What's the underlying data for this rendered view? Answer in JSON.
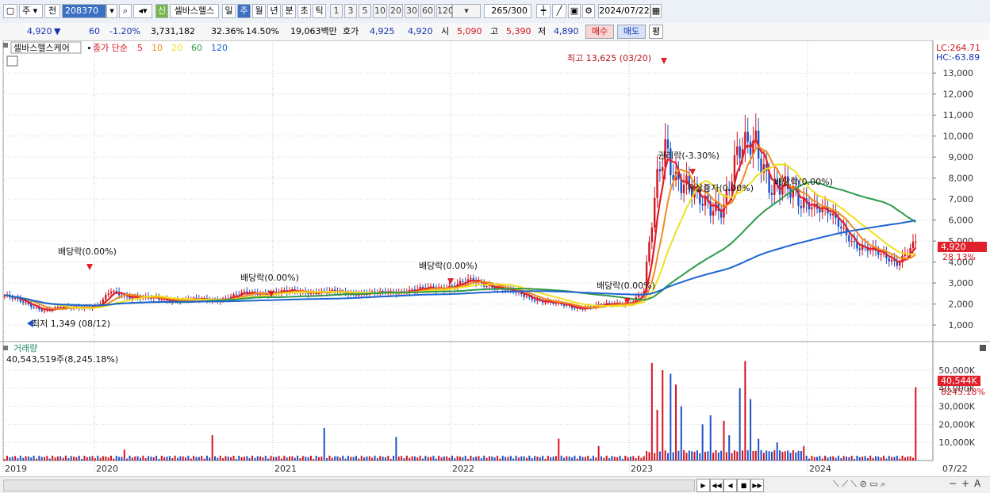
{
  "toolbar": {
    "market_type": "주",
    "prev_label": "전",
    "code": "208370",
    "badge_new": "신",
    "name": "셀바스헬스",
    "periods": [
      "일",
      "주",
      "월",
      "년",
      "분",
      "초",
      "틱"
    ],
    "active_period": "주",
    "intervals": [
      "1",
      "3",
      "5",
      "10",
      "20",
      "30",
      "60",
      "120"
    ],
    "count": "265",
    "count_total": "/300",
    "date": "2024/07/22"
  },
  "quote": {
    "price": "4,920",
    "arrow": "▼",
    "change": "60",
    "change_pct": "-1.20%",
    "volume": "3,731,182",
    "vol_ratio": "32.36%",
    "turnover_pct": "14.50%",
    "amount": "19,063백만",
    "bid_label": "호가",
    "bid1": "4,925",
    "bid2": "4,920",
    "open_label": "시",
    "open": "5,090",
    "high_label": "고",
    "high": "5,390",
    "low_label": "저",
    "low": "4,890",
    "buy_label": "매수",
    "sell_label": "매도",
    "eval_label": "평"
  },
  "chart": {
    "stock_label": "셀바스헬스케어",
    "ma_title": "종가 단순",
    "ma_periods": [
      "5",
      "10",
      "20",
      "60",
      "120"
    ],
    "ma_colors": [
      "#e0202a",
      "#f08c1e",
      "#f0e01e",
      "#2e9a4a",
      "#1e64d2"
    ],
    "lc_label": "LC:264.71",
    "hc_label": "HC:-63.89",
    "current_price_tag": "4,920",
    "current_pct_tag": "28.13%",
    "annotations": {
      "high": "최고 13,625 (03/20)",
      "low": "최저 1,349 (08/12)",
      "div1": "배당락(0.00%)",
      "div2": "배당락(0.00%)",
      "div3": "배당락(0.00%)",
      "div4": "배당락(0.00%)",
      "div5": "배당락(0.00%)",
      "rights": "권리락(-3.30%)",
      "capinc": "유상증자(0.00%)"
    },
    "volume_label": "거래량",
    "volume_value": "40,543,519주(8,245.18%)",
    "volume_tag": "40,544K",
    "volume_pct_tag": "8245.18%",
    "x_labels": [
      "2019",
      "2020",
      "2021",
      "2022",
      "2023",
      "2024",
      "07/22"
    ]
  },
  "chart_data": {
    "type": "candlestick",
    "title": "셀바스헬스케어",
    "price_ticks": [
      "13,000",
      "12,000",
      "11,000",
      "10,000",
      "9,000",
      "8,000",
      "7,000",
      "6,000",
      "5,000",
      "4,000",
      "3,000",
      "2,000",
      "1,000"
    ],
    "price_tick_values": [
      13000,
      12000,
      11000,
      10000,
      9000,
      8000,
      7000,
      6000,
      5000,
      4000,
      3000,
      2000,
      1000
    ],
    "volume_ticks": [
      "50,000K",
      "40,000K",
      "30,000K",
      "20,000K",
      "10,000K"
    ],
    "volume_tick_values": [
      50000,
      40000,
      30000,
      20000,
      10000
    ],
    "price_range": [
      400,
      13800
    ],
    "volume_range": [
      0,
      57000
    ],
    "weeks": 290,
    "close_knots": [
      [
        0,
        2400
      ],
      [
        15,
        1700
      ],
      [
        20,
        1800
      ],
      [
        35,
        1900
      ],
      [
        40,
        2600
      ],
      [
        45,
        2400
      ],
      [
        60,
        2200
      ],
      [
        80,
        2200
      ],
      [
        90,
        2500
      ],
      [
        110,
        2600
      ],
      [
        140,
        2500
      ],
      [
        165,
        2800
      ],
      [
        175,
        3100
      ],
      [
        185,
        2800
      ],
      [
        200,
        2200
      ],
      [
        215,
        1800
      ],
      [
        235,
        2100
      ],
      [
        240,
        2600
      ],
      [
        245,
        7800
      ],
      [
        248,
        9800
      ],
      [
        252,
        8200
      ],
      [
        260,
        6800
      ],
      [
        270,
        6800
      ],
      [
        275,
        8800
      ],
      [
        282,
        10000
      ],
      [
        288,
        7500
      ],
      [
        300,
        7000
      ],
      [
        310,
        6200
      ],
      [
        320,
        4800
      ],
      [
        335,
        4000
      ],
      [
        342,
        4920
      ]
    ],
    "volume_spikes": [
      [
        45,
        6000
      ],
      [
        78,
        14000
      ],
      [
        120,
        18000
      ],
      [
        147,
        13000
      ],
      [
        208,
        12000
      ],
      [
        223,
        8000
      ],
      [
        243,
        54000
      ],
      [
        245,
        28000
      ],
      [
        247,
        50000
      ],
      [
        250,
        48000
      ],
      [
        252,
        42000
      ],
      [
        254,
        30000
      ],
      [
        262,
        20000
      ],
      [
        265,
        25000
      ],
      [
        270,
        22000
      ],
      [
        272,
        14000
      ],
      [
        276,
        40000
      ],
      [
        278,
        55000
      ],
      [
        280,
        34000
      ],
      [
        283,
        12000
      ],
      [
        290,
        10000
      ],
      [
        300,
        8000
      ],
      [
        342,
        40544
      ]
    ],
    "series": [
      {
        "name": "5"
      },
      {
        "name": "10"
      },
      {
        "name": "20"
      },
      {
        "name": "60"
      },
      {
        "name": "120"
      }
    ]
  },
  "bottom": {
    "nav_buttons": [
      "▶",
      "◀◀",
      "◀",
      "■",
      "▶▶"
    ],
    "zoom": [
      "−",
      "+",
      "A"
    ]
  }
}
